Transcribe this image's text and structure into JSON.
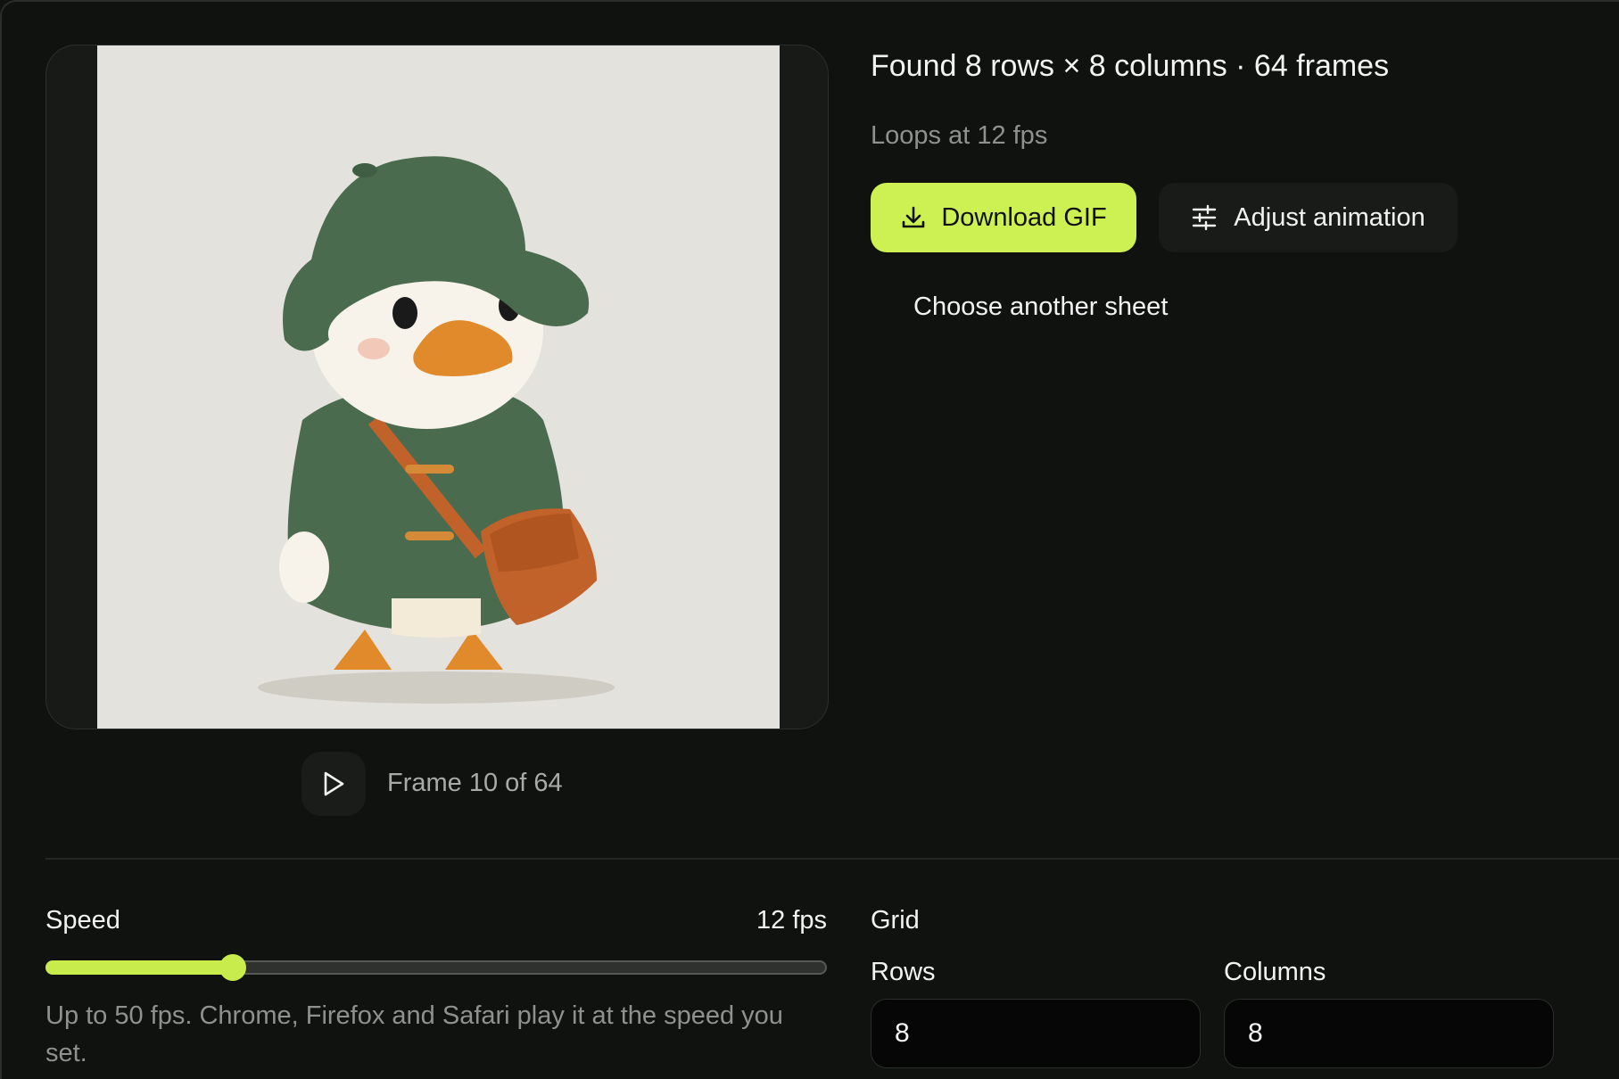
{
  "preview": {
    "frame_label": "Frame 10 of 64",
    "current_frame": 10,
    "total_frames": 64
  },
  "result": {
    "headline": "Found 8 rows × 8 columns · 64 frames",
    "subline": "Loops at 12 fps"
  },
  "actions": {
    "download_label": "Download GIF",
    "adjust_label": "Adjust animation",
    "another_label": "Choose another sheet"
  },
  "speed": {
    "label": "Speed",
    "value_label": "12 fps",
    "value": 12,
    "max": 50,
    "help": "Up to 50 fps. Chrome, Firefox and Safari play it at the speed you set."
  },
  "grid": {
    "label": "Grid",
    "rows_label": "Rows",
    "rows_value": "8",
    "columns_label": "Columns",
    "columns_value": "8"
  },
  "colors": {
    "accent": "#cdf153",
    "background": "#101210"
  }
}
